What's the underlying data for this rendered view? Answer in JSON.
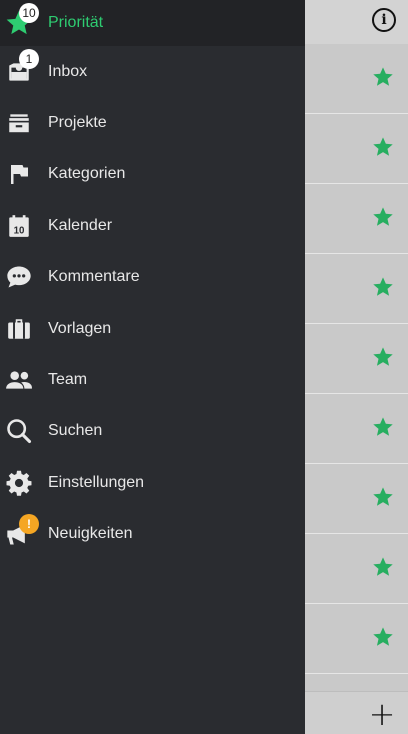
{
  "drawer": {
    "items": [
      {
        "label": "Priorität",
        "icon": "star-icon",
        "badge": "10",
        "active": true
      },
      {
        "label": "Inbox",
        "icon": "inbox-icon",
        "badge": "1"
      },
      {
        "label": "Projekte",
        "icon": "projects-icon"
      },
      {
        "label": "Kategorien",
        "icon": "flag-icon"
      },
      {
        "label": "Kalender",
        "icon": "calendar-icon",
        "icon_text": "10"
      },
      {
        "label": "Kommentare",
        "icon": "comment-icon"
      },
      {
        "label": "Vorlagen",
        "icon": "briefcase-icon"
      },
      {
        "label": "Team",
        "icon": "team-icon"
      },
      {
        "label": "Suchen",
        "icon": "search-icon"
      },
      {
        "label": "Einstellungen",
        "icon": "gear-icon"
      },
      {
        "label": "Neuigkeiten",
        "icon": "megaphone-icon",
        "badge": "!"
      }
    ]
  },
  "list": {
    "info_icon": "info-icon",
    "add_icon": "plus-icon",
    "row_star_icon": "star-icon",
    "row_count": 9
  },
  "colors": {
    "accent": "#2ecc71",
    "drawer_bg": "#2a2c30",
    "badge_alert": "#f5a623"
  }
}
